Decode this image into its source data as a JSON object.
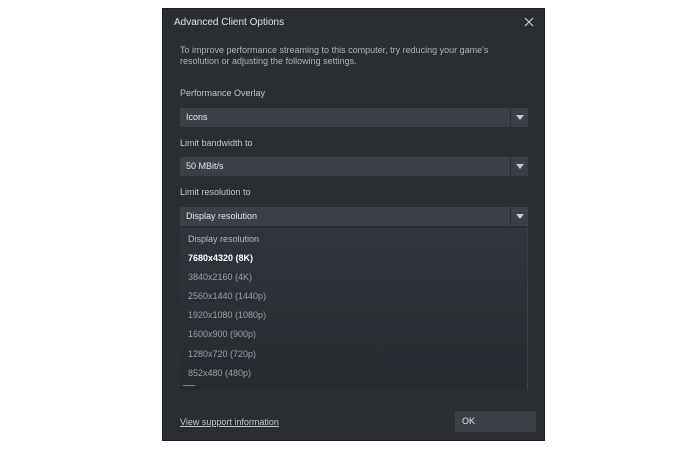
{
  "dialog": {
    "title": "Advanced Client Options",
    "description": "To improve performance streaming to this computer, try reducing your game's resolution or adjusting the following settings."
  },
  "performance_overlay": {
    "label": "Performance Overlay",
    "value": "Icons"
  },
  "bandwidth": {
    "label": "Limit bandwidth to",
    "value": "50 MBit/s"
  },
  "resolution": {
    "label": "Limit resolution to",
    "value": "Display resolution",
    "options": [
      "Display resolution",
      "7680x4320 (8K)",
      "3840x2160 (4K)",
      "2560x1440 (1440p)",
      "1920x1080 (1080p)",
      "1600x900 (900p)",
      "1280x720 (720p)",
      "852x480 (480p)"
    ]
  },
  "footer": {
    "support_link": "View support information",
    "ok_label": "OK"
  },
  "colors": {
    "dialog_bg": "#2a2e33",
    "control_bg": "#3b4047",
    "text": "#dfe3e6"
  },
  "icons": {
    "close": "close-icon",
    "dropdown": "chevron-down-icon"
  }
}
